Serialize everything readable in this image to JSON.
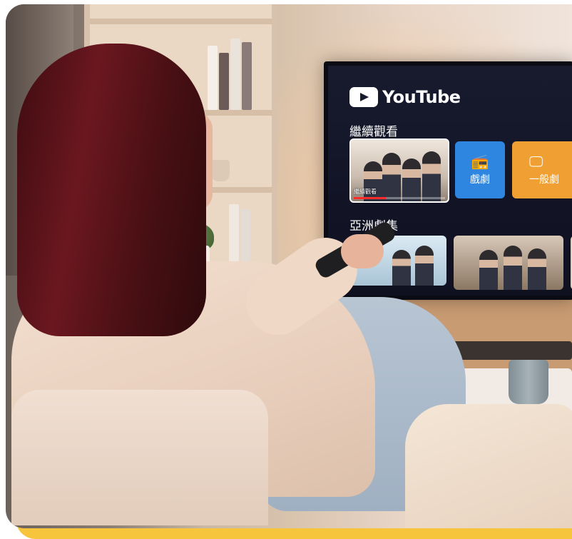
{
  "tv_ui": {
    "brand": "YouTube",
    "continue_section_title": "繼續觀看",
    "continue_thumb_label": "繼續觀看",
    "continue_progress": 0.35,
    "tiles": [
      {
        "label": "戲劇",
        "icon": "radio-icon",
        "color": "#2f86e0"
      },
      {
        "label": "一般劇",
        "icon": "monitor-icon",
        "color": "#f0a033"
      }
    ],
    "asia_section_title": "亞洲劇集"
  },
  "colors": {
    "accent_bar": "#f7c53c",
    "youtube_red": "#ff2b2b"
  }
}
